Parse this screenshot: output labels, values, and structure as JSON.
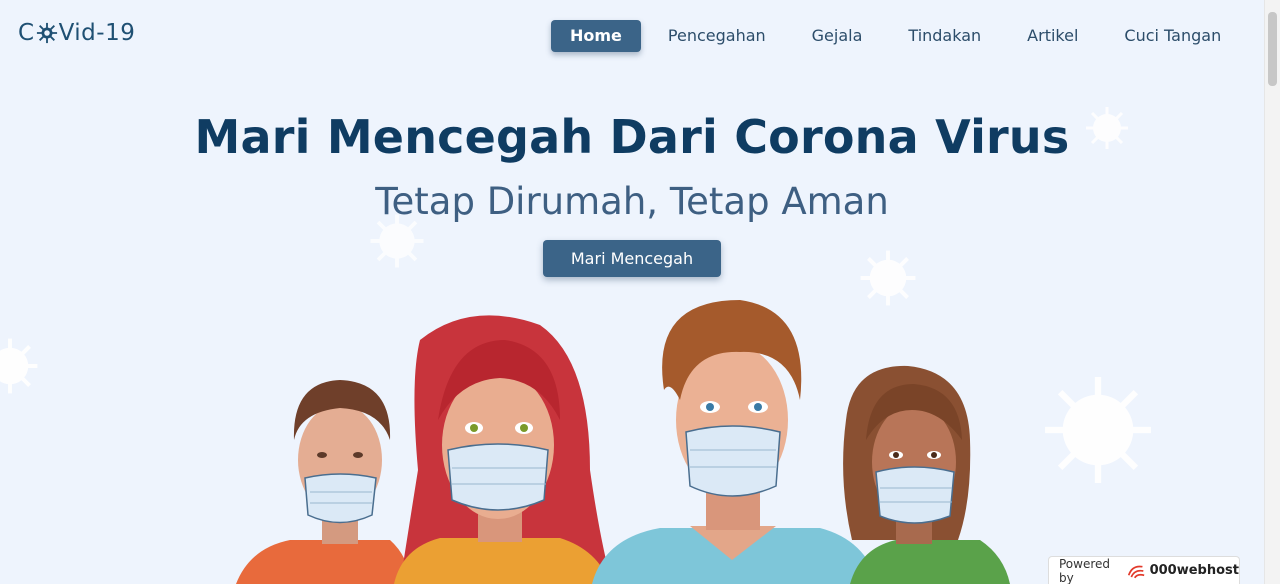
{
  "logo": {
    "prefix": "C",
    "suffix": "Vid-19"
  },
  "nav": {
    "items": [
      {
        "label": "Home",
        "active": true
      },
      {
        "label": "Pencegahan",
        "active": false
      },
      {
        "label": "Gejala",
        "active": false
      },
      {
        "label": "Tindakan",
        "active": false
      },
      {
        "label": "Artikel",
        "active": false
      },
      {
        "label": "Cuci Tangan",
        "active": false
      }
    ]
  },
  "hero": {
    "title": "Mari Mencegah Dari Corona Virus",
    "subtitle": "Tetap Dirumah, Tetap Aman",
    "cta_label": "Mari Mencegah"
  },
  "badge": {
    "prefix": "Powered by",
    "brand": "000webhost"
  },
  "colors": {
    "background": "#eef4fd",
    "primary": "#3b6488",
    "title": "#0f3c62"
  },
  "icons": {
    "logo_o": "virus-icon",
    "badge_logo": "000webhost-logo-icon"
  }
}
